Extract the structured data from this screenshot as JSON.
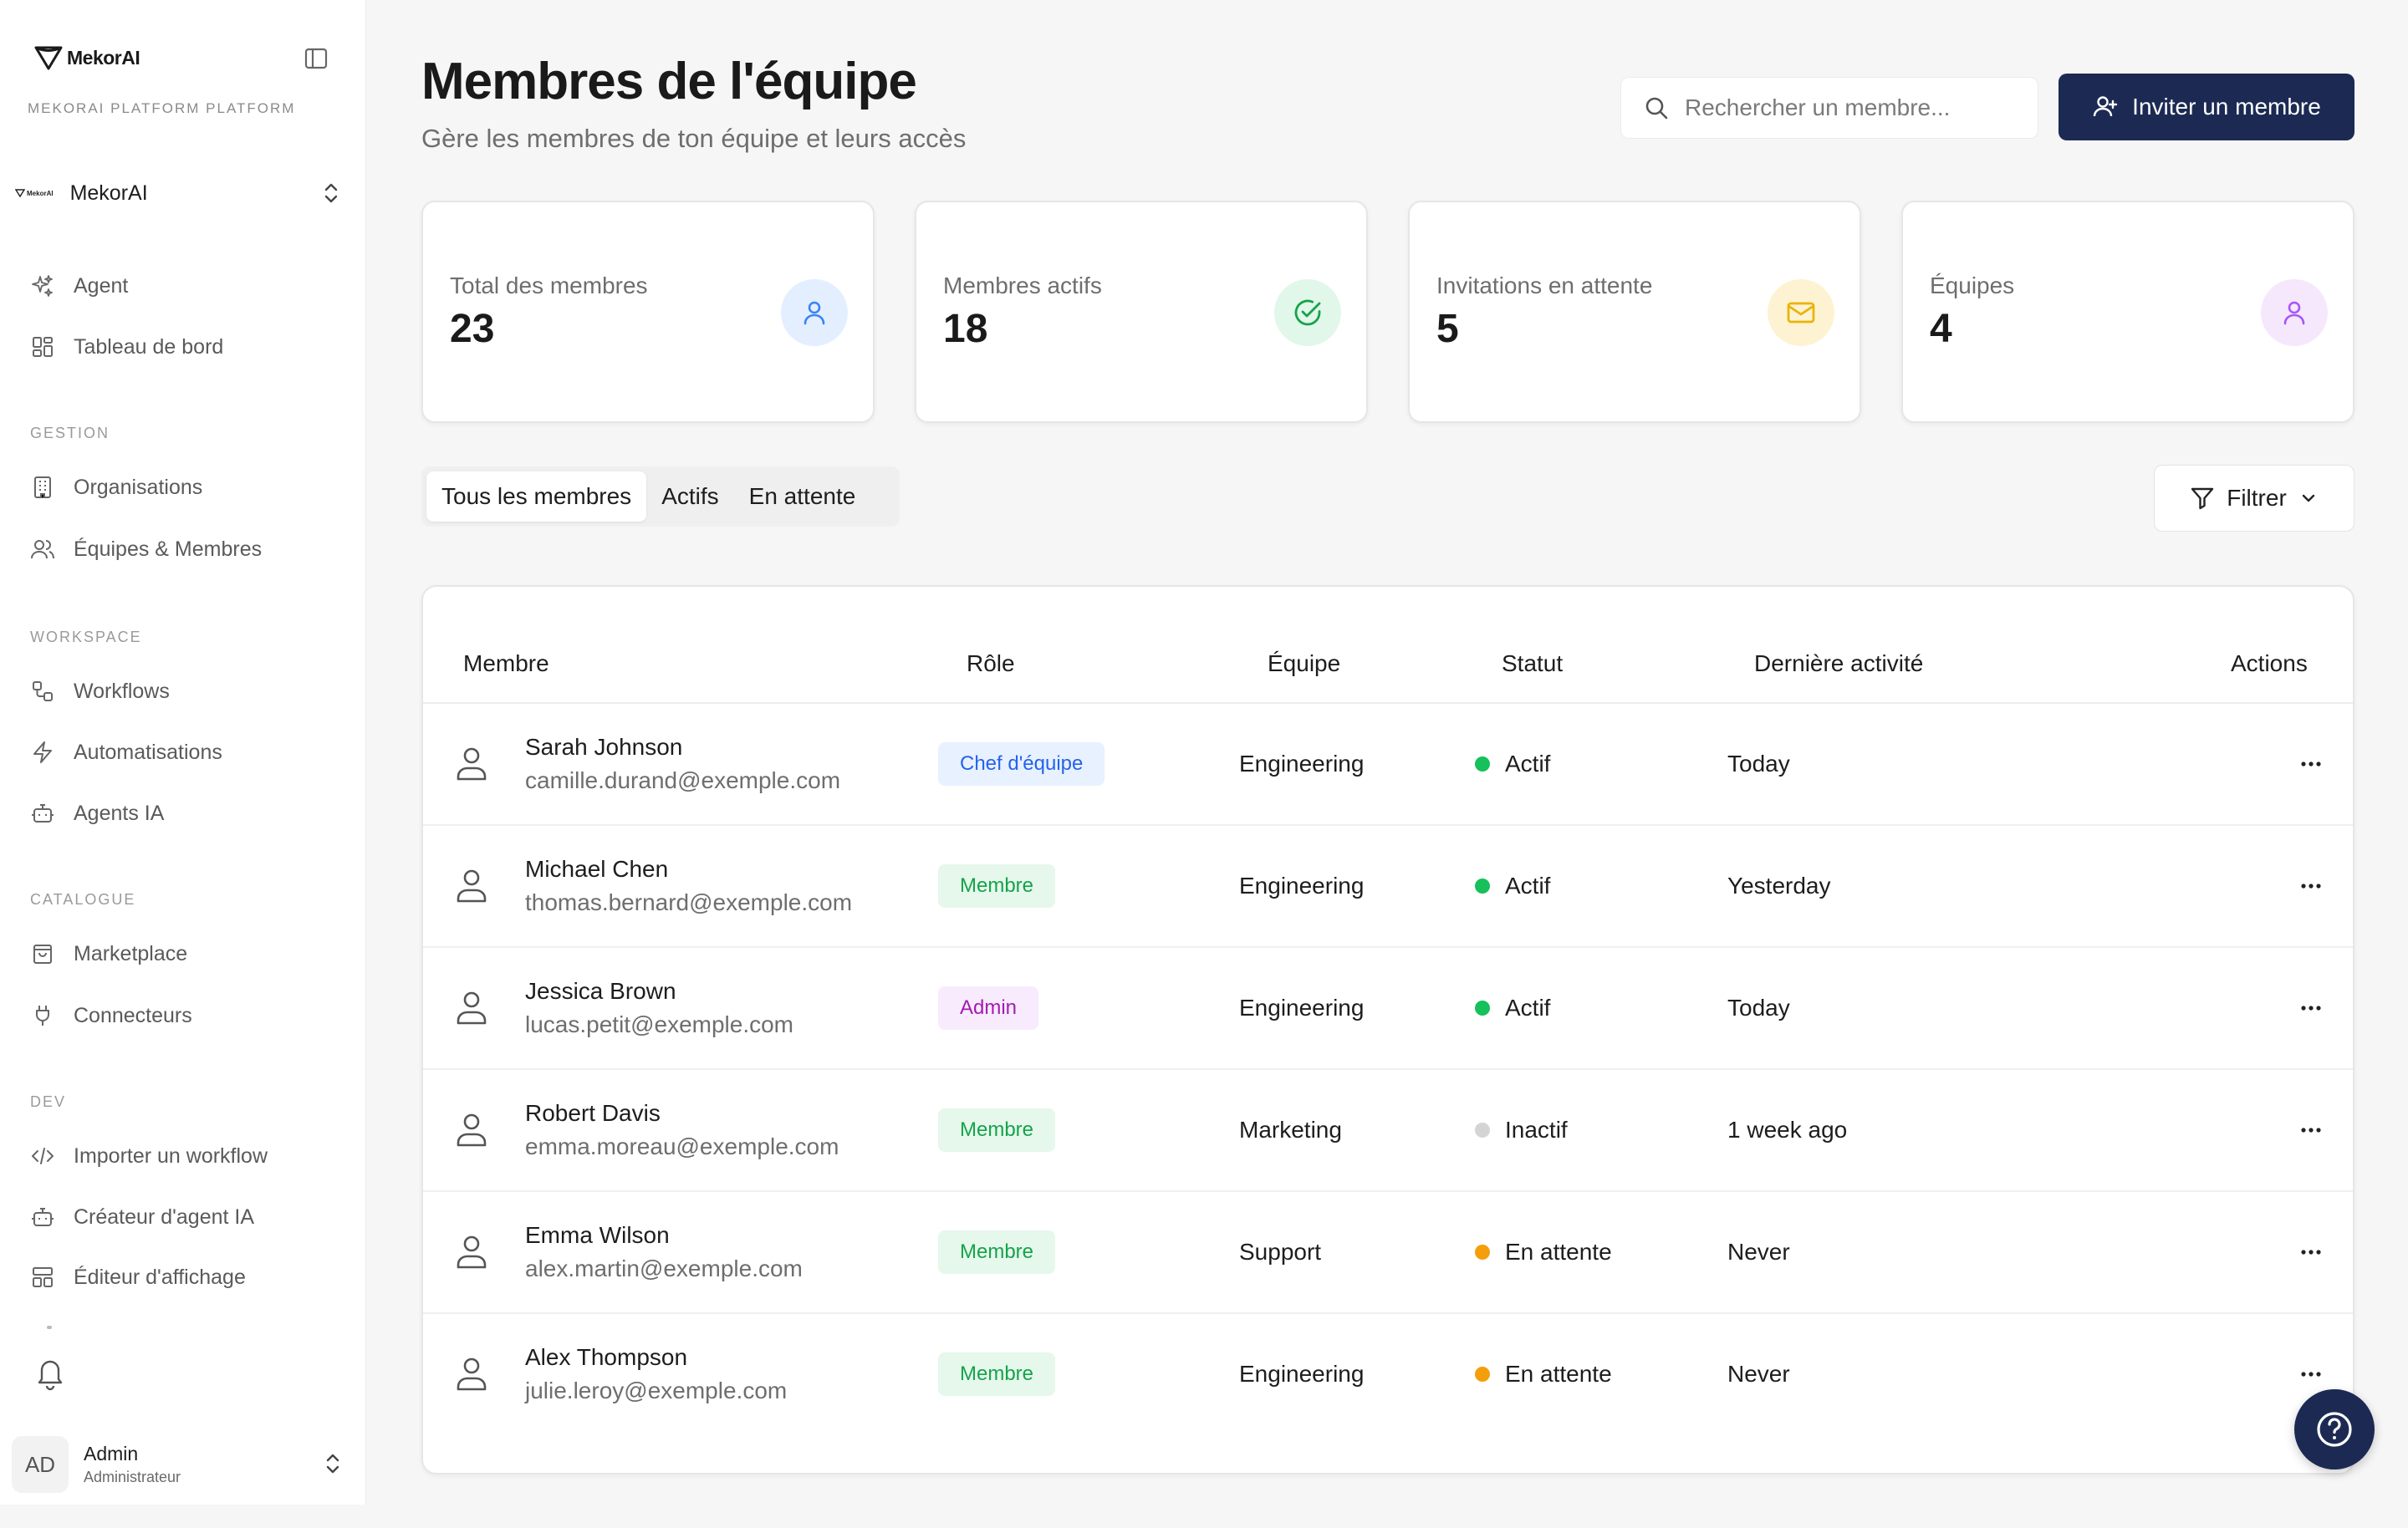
{
  "sidebar": {
    "brand_name": "MekorAI",
    "platform_label": "MEKORAI PLATFORM PLATFORM",
    "org": {
      "logo_text": "MekorAI",
      "name": "MekorAI"
    },
    "top_items": [
      {
        "label": "Agent",
        "icon": "sparkles-icon"
      },
      {
        "label": "Tableau de bord",
        "icon": "dashboard-icon"
      }
    ],
    "sections": [
      {
        "title": "GESTION",
        "items": [
          {
            "label": "Organisations",
            "icon": "building-icon"
          },
          {
            "label": "Équipes & Membres",
            "icon": "users-icon"
          }
        ]
      },
      {
        "title": "WORKSPACE",
        "items": [
          {
            "label": "Workflows",
            "icon": "workflow-icon"
          },
          {
            "label": "Automatisations",
            "icon": "zap-icon"
          },
          {
            "label": "Agents IA",
            "icon": "bot-icon"
          }
        ]
      },
      {
        "title": "CATALOGUE",
        "items": [
          {
            "label": "Marketplace",
            "icon": "shopping-bag-icon"
          },
          {
            "label": "Connecteurs",
            "icon": "plug-icon"
          }
        ]
      },
      {
        "title": "DEV",
        "items": [
          {
            "label": "Importer un workflow",
            "icon": "code-icon"
          },
          {
            "label": "Créateur d'agent IA",
            "icon": "bot-icon"
          },
          {
            "label": "Éditeur d'affichage",
            "icon": "layout-icon"
          }
        ]
      }
    ],
    "user": {
      "initials": "AD",
      "name": "Admin",
      "role": "Administrateur"
    }
  },
  "header": {
    "title": "Membres de l'équipe",
    "subtitle": "Gère les membres de ton équipe et leurs accès",
    "search_placeholder": "Rechercher un membre...",
    "invite_label": "Inviter un membre"
  },
  "stats": [
    {
      "label": "Total des membres",
      "value": "23",
      "icon": "user-icon",
      "color": "#3b82f6",
      "bg": "#e3efff"
    },
    {
      "label": "Membres actifs",
      "value": "18",
      "icon": "check-circle-icon",
      "color": "#16a34a",
      "bg": "#e1f7ea"
    },
    {
      "label": "Invitations en attente",
      "value": "5",
      "icon": "mail-icon",
      "color": "#eab308",
      "bg": "#fdf3d2"
    },
    {
      "label": "Équipes",
      "value": "4",
      "icon": "user-icon",
      "color": "#a855f7",
      "bg": "#f5e8fd"
    }
  ],
  "tabs": [
    "Tous les membres",
    "Actifs",
    "En attente"
  ],
  "filter_label": "Filtrer",
  "table": {
    "columns": [
      "Membre",
      "Rôle",
      "Équipe",
      "Statut",
      "Dernière activité",
      "Actions"
    ],
    "rows": [
      {
        "name": "Sarah Johnson",
        "email": "camille.durand@exemple.com",
        "role": "Chef d'équipe",
        "role_kind": "lead",
        "team": "Engineering",
        "status": "Actif",
        "status_kind": "active",
        "activity": "Today"
      },
      {
        "name": "Michael Chen",
        "email": "thomas.bernard@exemple.com",
        "role": "Membre",
        "role_kind": "member",
        "team": "Engineering",
        "status": "Actif",
        "status_kind": "active",
        "activity": "Yesterday"
      },
      {
        "name": "Jessica Brown",
        "email": "lucas.petit@exemple.com",
        "role": "Admin",
        "role_kind": "admin",
        "team": "Engineering",
        "status": "Actif",
        "status_kind": "active",
        "activity": "Today"
      },
      {
        "name": "Robert Davis",
        "email": "emma.moreau@exemple.com",
        "role": "Membre",
        "role_kind": "member",
        "team": "Marketing",
        "status": "Inactif",
        "status_kind": "inactive",
        "activity": "1 week ago"
      },
      {
        "name": "Emma Wilson",
        "email": "alex.martin@exemple.com",
        "role": "Membre",
        "role_kind": "member",
        "team": "Support",
        "status": "En attente",
        "status_kind": "pending",
        "activity": "Never"
      },
      {
        "name": "Alex Thompson",
        "email": "julie.leroy@exemple.com",
        "role": "Membre",
        "role_kind": "member",
        "team": "Engineering",
        "status": "En attente",
        "status_kind": "pending",
        "activity": "Never"
      }
    ]
  },
  "colors": {
    "primary": "#1c2a53",
    "status_active": "#16c05a",
    "status_inactive": "#d4d4d4",
    "status_pending": "#f59e0b",
    "badge_lead_bg": "#e8f1ff",
    "badge_lead_fg": "#2563eb",
    "badge_member_bg": "#e6f7ec",
    "badge_member_fg": "#15a34a",
    "badge_admin_bg": "#f7ebfd",
    "badge_admin_fg": "#a21caf"
  }
}
